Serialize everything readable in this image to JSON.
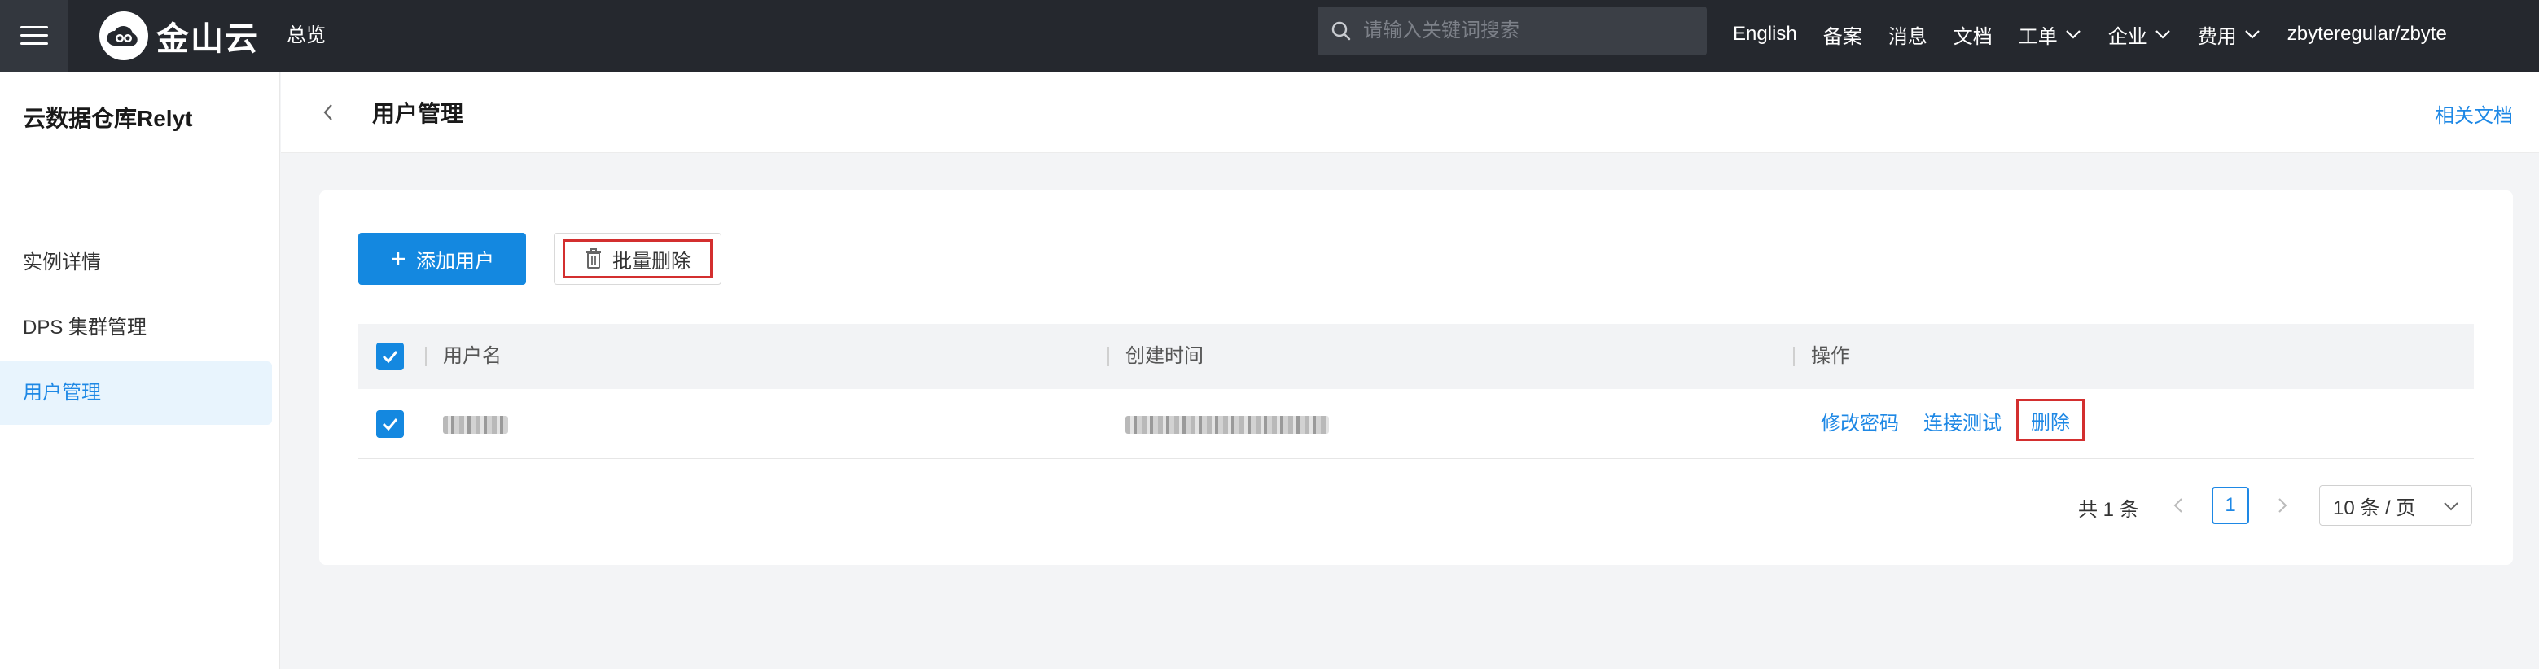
{
  "topbar": {
    "logo_text": "金山云",
    "overview": "总览",
    "search_placeholder": "请输入关键词搜索",
    "links": [
      {
        "label": "English",
        "dropdown": false
      },
      {
        "label": "备案",
        "dropdown": false
      },
      {
        "label": "消息",
        "dropdown": false
      },
      {
        "label": "文档",
        "dropdown": false
      },
      {
        "label": "工单",
        "dropdown": true
      },
      {
        "label": "企业",
        "dropdown": true
      },
      {
        "label": "费用",
        "dropdown": true
      },
      {
        "label": "zbyteregular/zbyte",
        "dropdown": false
      }
    ]
  },
  "sidebar": {
    "title": "云数据仓库Relyt",
    "items": [
      {
        "label": "实例详情",
        "active": false
      },
      {
        "label": "DPS 集群管理",
        "active": false
      },
      {
        "label": "用户管理",
        "active": true
      }
    ]
  },
  "header": {
    "title": "用户管理",
    "related_docs": "相关文档"
  },
  "toolbar": {
    "add_user": "添加用户",
    "batch_delete": "批量删除"
  },
  "table": {
    "columns": [
      "用户名",
      "创建时间",
      "操作"
    ],
    "rows": [
      {
        "checked": true,
        "actions": [
          "修改密码",
          "连接测试",
          "删除"
        ]
      }
    ]
  },
  "pagination": {
    "total": "共 1 条",
    "current": "1",
    "page_size": "10 条 / 页"
  },
  "colors": {
    "topbar_bg": "#25282e",
    "accent": "#1488e0",
    "highlight_border": "#d32f2f"
  }
}
